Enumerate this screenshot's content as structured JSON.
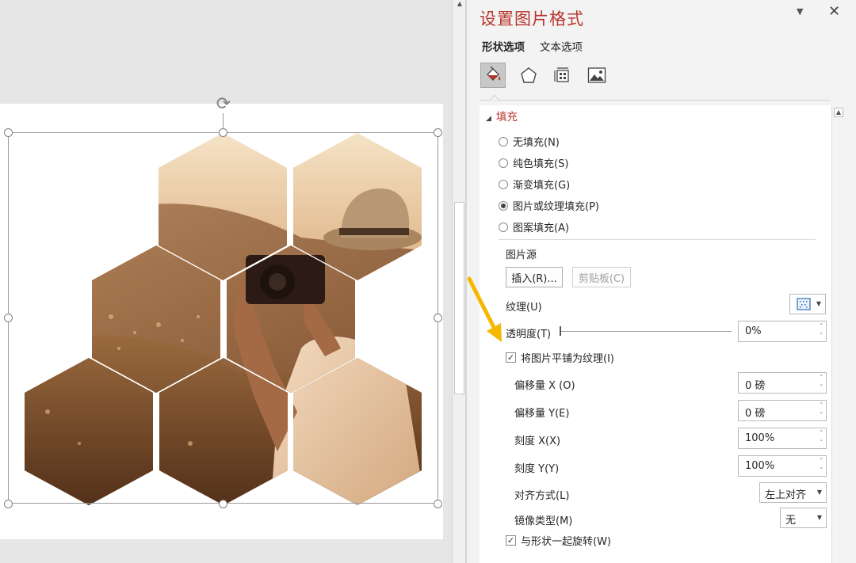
{
  "panel": {
    "title": "设置图片格式",
    "dropdown_icon": "chevron-down-icon",
    "close_icon": "close-icon",
    "tabs": [
      {
        "label": "形状选项",
        "active": true
      },
      {
        "label": "文本选项",
        "active": false
      }
    ],
    "categories": [
      {
        "name": "fill-line",
        "icon": "paint-bucket-icon",
        "active": true
      },
      {
        "name": "effects",
        "icon": "pentagon-icon",
        "active": false
      },
      {
        "name": "size-properties",
        "icon": "size-properties-icon",
        "active": false
      },
      {
        "name": "picture",
        "icon": "picture-icon",
        "active": false
      }
    ]
  },
  "fill": {
    "section_label": "填充",
    "options": [
      {
        "label": "无填充(N)",
        "selected": false
      },
      {
        "label": "纯色填充(S)",
        "selected": false
      },
      {
        "label": "渐变填充(G)",
        "selected": false
      },
      {
        "label": "图片或纹理填充(P)",
        "selected": true
      },
      {
        "label": "图案填充(A)",
        "selected": false
      }
    ],
    "picture_source_label": "图片源",
    "insert_button": "插入(R)...",
    "clipboard_button": "剪贴板(C)",
    "texture_label": "纹理(U)",
    "transparency_label": "透明度(T)",
    "transparency_value": "0%",
    "transparency_percent": 0,
    "tile_checkbox_label": "将图片平铺为纹理(I)",
    "tile_checked": true,
    "offset_x_label": "偏移量 X (O)",
    "offset_x_value": "0 磅",
    "offset_y_label": "偏移量 Y(E)",
    "offset_y_value": "0 磅",
    "scale_x_label": "刻度 X(X)",
    "scale_x_value": "100%",
    "scale_y_label": "刻度 Y(Y)",
    "scale_y_value": "100%",
    "alignment_label": "对齐方式(L)",
    "alignment_value": "左上对齐",
    "mirror_label": "镜像类型(M)",
    "mirror_value": "无",
    "rotate_checkbox_label": "与形状一起旋转(W)",
    "rotate_checked": true
  },
  "colors": {
    "accent": "#b8352d",
    "arrow": "#f5b800"
  }
}
